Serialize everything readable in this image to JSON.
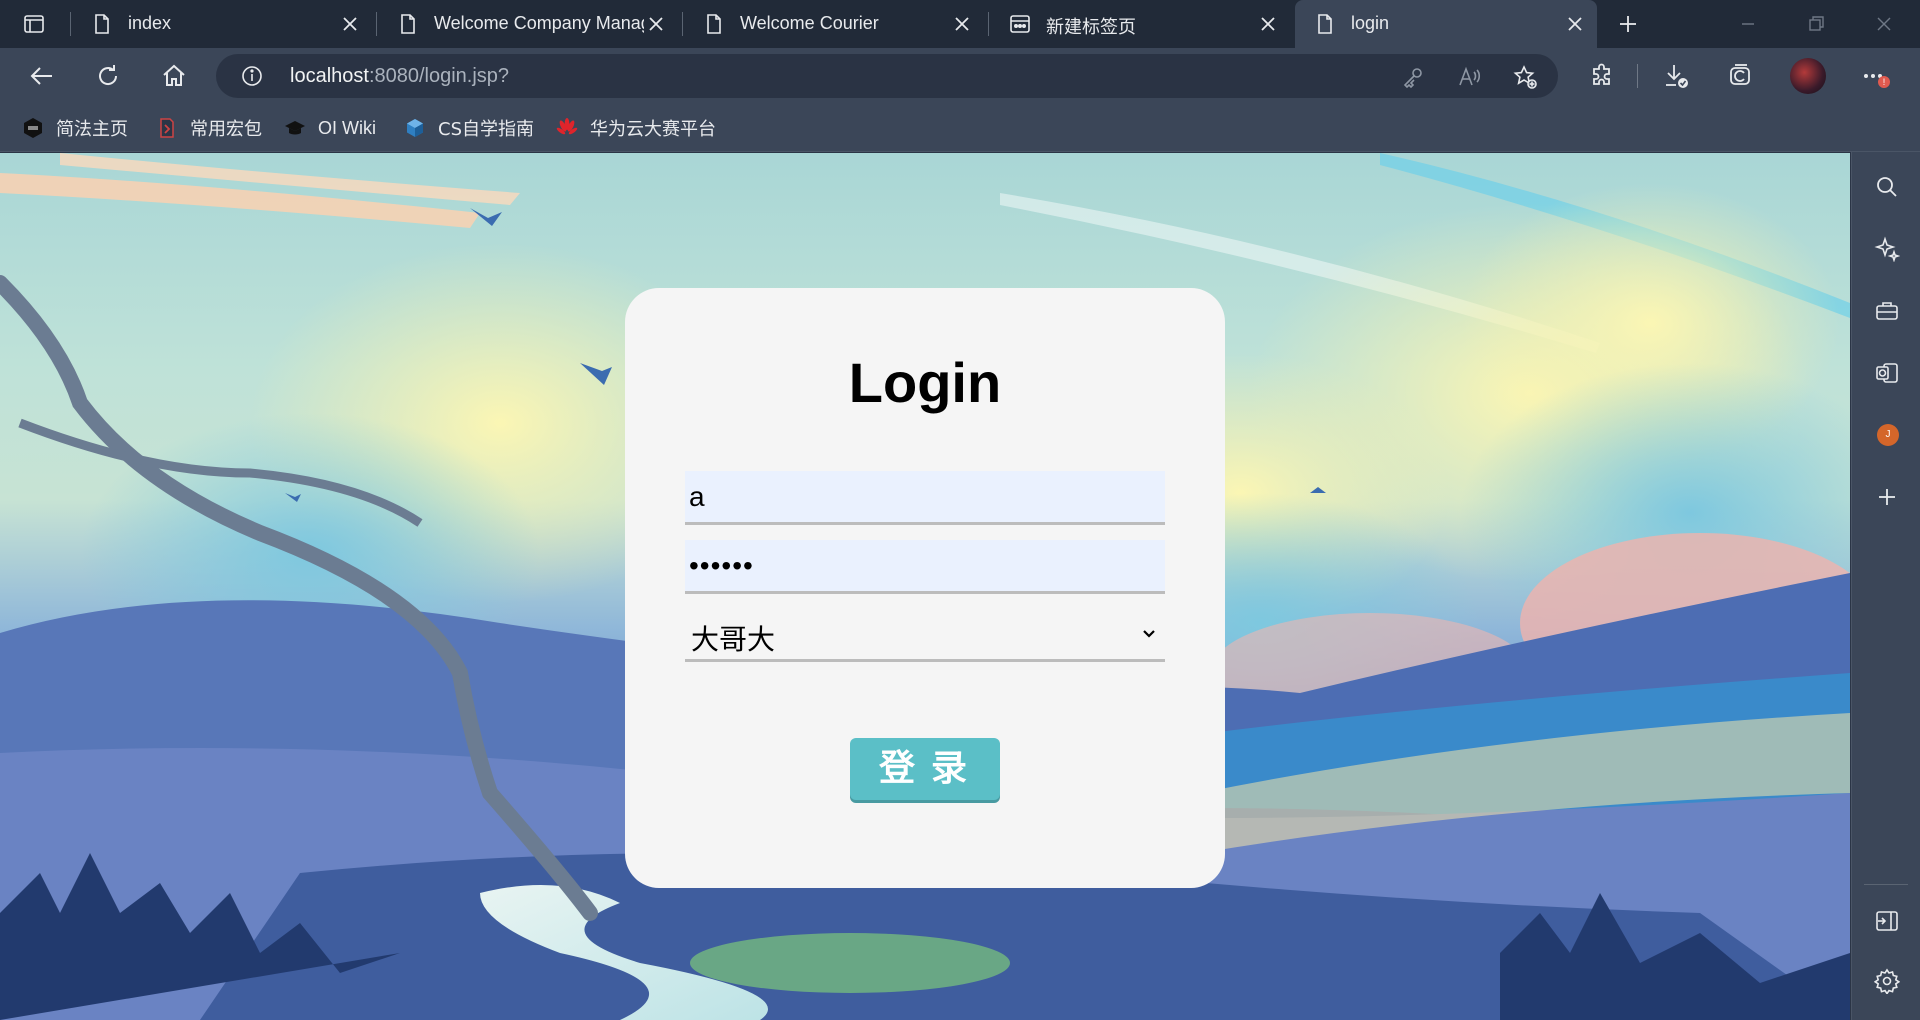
{
  "browser": {
    "tabs": [
      {
        "title": "index",
        "icon": "page-icon",
        "active": false
      },
      {
        "title": "Welcome Company Manag",
        "icon": "page-icon",
        "active": false
      },
      {
        "title": "Welcome Courier",
        "icon": "page-icon",
        "active": false
      },
      {
        "title": "新建标签页",
        "icon": "new-tab-page-icon",
        "active": false
      },
      {
        "title": "login",
        "icon": "page-icon",
        "active": true
      }
    ],
    "address": {
      "host": "localhost",
      "path": ":8080/login.jsp?"
    },
    "bookmarks": [
      {
        "label": "简法主页",
        "icon": "jianfa-icon"
      },
      {
        "label": "常用宏包",
        "icon": "bookmark-icon"
      },
      {
        "label": "OI Wiki",
        "icon": "graduation-cap-icon"
      },
      {
        "label": "CS自学指南",
        "icon": "cube-icon"
      },
      {
        "label": "华为云大赛平台",
        "icon": "huawei-icon"
      }
    ],
    "colors": {
      "tab_strip": "#212a38",
      "toolbar": "#3b4658",
      "address_bg": "#2a3344"
    }
  },
  "login": {
    "title": "Login",
    "username_value": "a",
    "password_value": "••••••",
    "role_selected": "大哥大",
    "button_label": "登录",
    "colors": {
      "card": "#f5f5f5",
      "input_bg": "#eaf1fe",
      "button": "#5bbfc7"
    }
  }
}
